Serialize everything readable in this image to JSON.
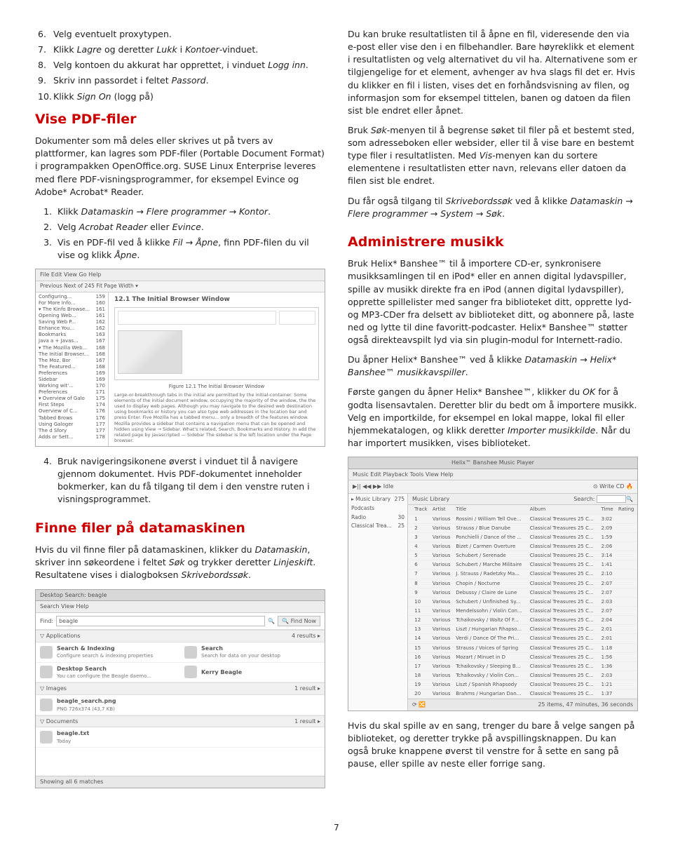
{
  "left": {
    "ol_start6": [
      "Velg eventuelt proxytypen.",
      "Klikk <em>Lagre</em> og deretter <em>Lukk</em> i <em>Kontoer</em>-vinduet.",
      "Velg kontoen du akkurat har opprettet, i vinduet <em>Logg inn</em>.",
      "Skriv inn passordet i feltet <em>Passord</em>.",
      "Klikk <em>Sign On</em> (logg på)"
    ],
    "h_pdf": "Vise PDF-filer",
    "p_pdf": "Dokumenter som må deles eller skrives ut på tvers av plattformer, kan lagres som PDF-filer (Portable Document Format) i programpakken OpenOffice.org. SUSE Linux Enterprise leveres med flere PDF-visningsprogrammer, for eksempel Evince og Adobe* Acrobat* Reader.",
    "ol_pdf": [
      "Klikk <em>Datamaskin → Flere programmer → Kontor</em>.",
      "Velg <em>Acrobat Reader</em> eller <em>Evince</em>.",
      "Vis en PDF-fil ved å klikke <em>Fil → Åpne</em>, finn PDF-filen du vil vise og klikk <em>Åpne</em>."
    ],
    "pdf_fig": {
      "menubar": "File  Edit  View  Go  Help",
      "toolbar": "Previous  Next      of 245   Fit Page Width ▾",
      "side_rows": [
        [
          "Configuring...",
          "159"
        ],
        [
          "For More Info...",
          "160"
        ],
        [
          "▾ The Kinfo Browse...",
          "161"
        ],
        [
          "Opening Web...",
          "161"
        ],
        [
          "Saving Web P...",
          "162"
        ],
        [
          "Enhance You...",
          "162"
        ],
        [
          "Bookmarks",
          "163"
        ],
        [
          "Java a + Javas...",
          "167"
        ],
        [
          "▾ The Mozilla Web...",
          "168"
        ],
        [
          "The Initial Browser...",
          "168"
        ],
        [
          "The Moz. Bor",
          "167"
        ],
        [
          "The Featured...",
          "168"
        ],
        [
          "Preferences",
          "169"
        ],
        [
          "Sidebar",
          "169"
        ],
        [
          "Working wit'...",
          "170"
        ],
        [
          "Preferences",
          "171"
        ],
        [
          "▾ Overview of Galo",
          "175"
        ],
        [
          "First Steps",
          "174"
        ],
        [
          "Overview of C...",
          "176"
        ],
        [
          "Tabbed Brows",
          "176"
        ],
        [
          "Using Galoger",
          "177"
        ],
        [
          "The d Sfory",
          "177"
        ],
        [
          "Adds or Sett...",
          "178"
        ]
      ],
      "main_title": "12.1   The Initial Browser Window",
      "caption": "Figure 12.1 The Initial Browser Window",
      "blurb": "Large-or-breakthrough tabs in the initial are permitted by the initial-container. Some elements of the initial document window, occupying the majority of the window, the the used to display web pages. Although you may navigate to the desired web destination using bookmarks or history you can also type web addresses in the location bar and press Enter. Five Mozilla has a tabbed menu... only a breadth of the features window. Mozilla provides a sidebar that contains a navigation menu that can be opened and hidden using View → Sidebar. What's related, Search, Bookmarks and History. In add the related page by javascripted — Sidebar The sidebar is the left location under the Page browser."
    },
    "ol_pdf2": [
      "Bruk navigeringsikonene øverst i vinduet til å navigere gjennom dokumentet. Hvis PDF-dokumentet inneholder bokmerker, kan du få tilgang til dem i den venstre ruten i visningsprogrammet."
    ],
    "h_find": "Finne filer på datamaskinen",
    "p_find": "Hvis du vil finne filer på datamaskinen, klikker du <em>Datamaskin</em>, skriver inn søkeordene i feltet <em>Søk</em> og trykker deretter <em>Linjeskift</em>. Resultatene vises i dialogboksen <em>Skrivebordssøk</em>.",
    "search_fig": {
      "title": "Desktop Search: beagle",
      "menubar": "Search  View  Help",
      "find_label": "Find:",
      "find_value": "beagle",
      "find_btn": "Find Now",
      "cat_apps": "Applications",
      "cat_apps_count": "4 results ▸",
      "results_apps": [
        {
          "name": "Search & Indexing",
          "meta": "Configure search & indexing properties"
        },
        {
          "name": "Search",
          "meta": "Search for data on your desktop"
        },
        {
          "name": "Desktop Search",
          "meta": "You can configure the Beagle daemo..."
        },
        {
          "name": "Kerry Beagle",
          "meta": ""
        }
      ],
      "cat_images": "Images",
      "cat_images_count": "1 result ▸",
      "results_images": [
        {
          "name": "beagle_search.png",
          "meta": "PNG 726x374 (43,7 KB)"
        }
      ],
      "cat_docs": "Documents",
      "cat_docs_count": "1 result ▸",
      "results_docs": [
        {
          "name": "beagle.txt",
          "meta": "Today"
        }
      ],
      "status": "Showing all 6 matches"
    }
  },
  "right": {
    "p1": "Du kan bruke resultatlisten til å åpne en fil, videresende den via e-post eller vise den i en filbehandler. Bare høyreklikk et element i resultatlisten og velg alternativet du vil ha. Alternativene som er tilgjengelige for et element, avhenger av hva slags fil det er. Hvis du klikker en fil i listen, vises det en forhåndsvisning av filen, og informasjon som for eksempel tittelen, banen og datoen da filen sist ble endret eller åpnet.",
    "p2": "Bruk <em>Søk</em>-menyen til å begrense søket til filer på et bestemt sted, som adresseboken eller websider, eller til å vise bare en bestemt type filer i resultatlisten. Med <em>Vis</em>-menyen kan du sortere elementene i resultatlisten etter navn, relevans eller datoen da filen sist ble endret.",
    "p3": "Du får også tilgang til <em>Skrivebordssøk</em> ved å klikke <em>Datamaskin → Flere programmer → System → Søk</em>.",
    "h_music": "Administrere musikk",
    "p_music1": "Bruk Helix* Banshee™ til å importere CD-er, synkronisere musikksamlingen til en iPod* eller en annen digital lydavspiller, spille av musikk direkte fra en iPod (annen digital lydavspiller), opprette spillelister med sanger fra biblioteket ditt, opprette lyd- og MP3-CDer fra delsett av biblioteket ditt, og abonnere på, laste ned og lytte til dine favoritt-podcaster. Helix* Banshee™ støtter også direkteavspilt lyd via sin plugin-modul for Internett-radio.",
    "p_music2": "Du åpner Helix* Banshee™ ved å klikke <em>Datamaskin → Helix* Banshee™ musikkavspiller</em>.",
    "p_music3": "Første gangen du åpner Helix* Banshee™, klikker du <em>OK</em> for å godta lisensavtalen. Deretter blir du bedt om å importere musikk. Velg en importkilde, for eksempel en lokal mappe, lokal fil eller hjemmekatalogen, og klikk deretter <em>Importer musikkilde</em>. Når du har importert musikken, vises biblioteket.",
    "banshee": {
      "title": "Helix™ Banshee Music Player",
      "menubar": "Music  Edit  Playback  Tools  View  Help",
      "toolbar_left": "▶||  ◀◀  ▶▶     Idle",
      "toolbar_right": "⊙ Write CD   🔥",
      "side": [
        {
          "label": "▸ Music Library",
          "count": "275"
        },
        {
          "label": "  Podcasts",
          "count": ""
        },
        {
          "label": "  Radio",
          "count": "30"
        },
        {
          "label": "  Classical Trea...",
          "count": "25"
        }
      ],
      "tab_label": "Music Library",
      "search_label": "Search:",
      "columns": [
        "",
        "Track",
        "Artist",
        "Title",
        "Album",
        "Time",
        "Rating"
      ],
      "rows": [
        [
          "",
          "1",
          "Various",
          "Rossini / William Tell Ove...",
          "Classical Treasures 25 C...",
          "3:02",
          ""
        ],
        [
          "",
          "2",
          "Various",
          "Strauss / Blue Danube",
          "Classical Treasures 25 C...",
          "2:09",
          ""
        ],
        [
          "",
          "3",
          "Various",
          "Ponchielli / Dance of the ...",
          "Classical Treasures 25 C...",
          "1:59",
          ""
        ],
        [
          "",
          "4",
          "Various",
          "Bizet / Carmen Overture",
          "Classical Treasures 25 C...",
          "2:06",
          ""
        ],
        [
          "",
          "5",
          "Various",
          "Schubert / Serenade",
          "Classical Treasures 25 C...",
          "3:14",
          ""
        ],
        [
          "",
          "6",
          "Various",
          "Schubert / Marche Militaire",
          "Classical Treasures 25 C...",
          "1:41",
          ""
        ],
        [
          "",
          "7",
          "Various",
          "J. Strauss / Radetzky Ma...",
          "Classical Treasures 25 C...",
          "2:10",
          ""
        ],
        [
          "",
          "8",
          "Various",
          "Chopin / Nocturne",
          "Classical Treasures 25 C...",
          "2:07",
          ""
        ],
        [
          "",
          "9",
          "Various",
          "Debussy / Claire de Lune",
          "Classical Treasures 25 C...",
          "2:07",
          ""
        ],
        [
          "",
          "10",
          "Various",
          "Schubert / Unfinished Sy...",
          "Classical Treasures 25 C...",
          "2:03",
          ""
        ],
        [
          "",
          "11",
          "Various",
          "Mendelssohn / Violin Con...",
          "Classical Treasures 25 C...",
          "2:07",
          ""
        ],
        [
          "",
          "12",
          "Various",
          "Tchaikovsky / Waltz Of F...",
          "Classical Treasures 25 C...",
          "2:04",
          ""
        ],
        [
          "",
          "13",
          "Various",
          "Liszt / Hungarian Rhapso...",
          "Classical Treasures 25 C...",
          "2:01",
          ""
        ],
        [
          "",
          "14",
          "Various",
          "Verdi / Dance Of The Pri...",
          "Classical Treasures 25 C...",
          "2:01",
          ""
        ],
        [
          "",
          "15",
          "Various",
          "Strauss / Voices of Spring",
          "Classical Treasures 25 C...",
          "1:18",
          ""
        ],
        [
          "",
          "16",
          "Various",
          "Mozart / Minuet in D",
          "Classical Treasures 25 C...",
          "1:56",
          ""
        ],
        [
          "",
          "17",
          "Various",
          "Tchaikovsky / Sleeping B...",
          "Classical Treasures 25 C...",
          "1:36",
          ""
        ],
        [
          "",
          "18",
          "Various",
          "Tchaikovsky / Violin Con...",
          "Classical Treasures 25 C...",
          "2:03",
          ""
        ],
        [
          "",
          "19",
          "Various",
          "Liszt / Spanish Rhapsody",
          "Classical Treasures 25 C...",
          "1:21",
          ""
        ],
        [
          "",
          "20",
          "Various",
          "Brahms / Hungarian Dan...",
          "Classical Treasures 25 C...",
          "1:37",
          ""
        ]
      ],
      "status": "25 items, 47 minutes, 36 seconds",
      "repeat": "⟳ 🔀"
    },
    "p_music4": "Hvis du skal spille av en sang, trenger du bare å velge sangen på biblioteket, og deretter trykke på avspillingsknappen. Du kan også bruke knappene øverst til venstre for å sette en sang på pause, eller spille av neste eller forrige sang."
  },
  "page_number": "7"
}
